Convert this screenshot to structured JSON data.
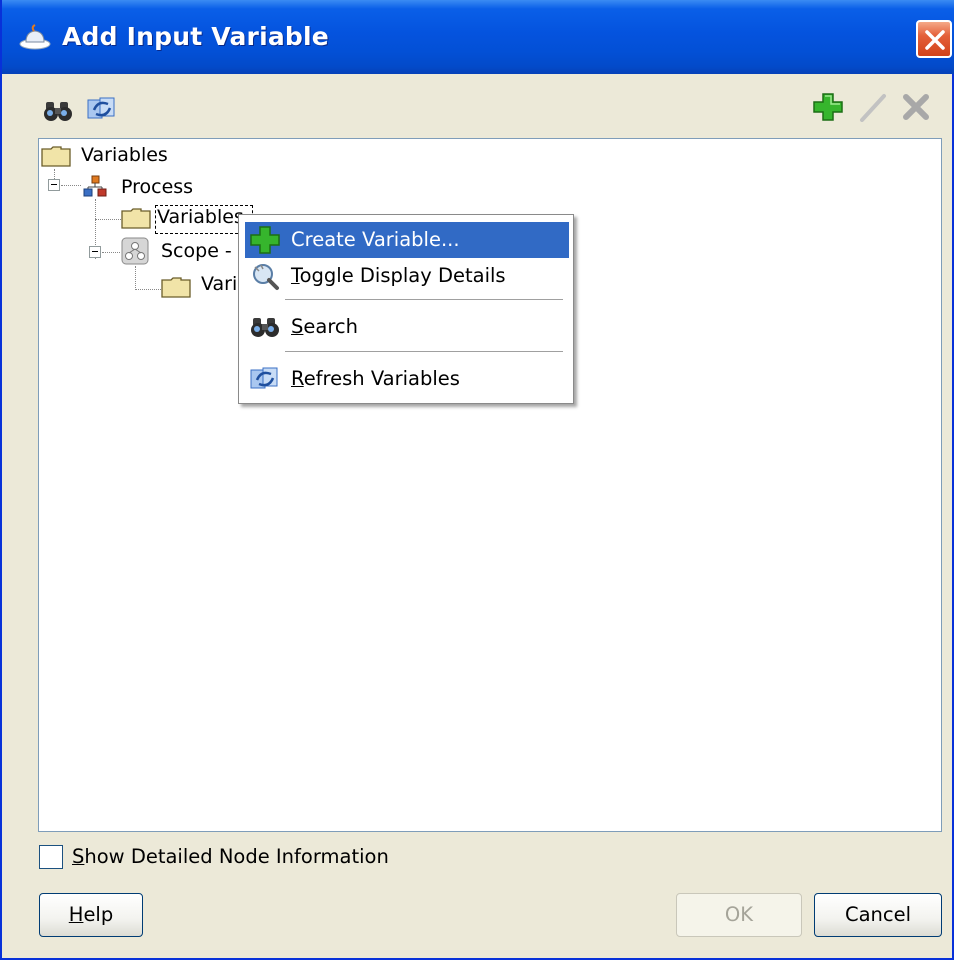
{
  "window": {
    "title": "Add Input Variable"
  },
  "toolbar": {
    "left_icons": [
      "binoculars-icon",
      "refresh-icon"
    ],
    "right_icons": [
      "add-icon",
      "edit-icon",
      "delete-icon"
    ]
  },
  "tree": {
    "root": "Variables",
    "process": "Process",
    "process_variables": "Variables",
    "scope": "Scope -",
    "scope_variables": "Vari"
  },
  "context_menu": {
    "create_variable": "Create Variable...",
    "toggle_prefix": "T",
    "toggle_rest": "oggle Display Details",
    "search_prefix": "S",
    "search_rest": "earch",
    "refresh_prefix": "R",
    "refresh_rest": "efresh Variables"
  },
  "options": {
    "show_detailed_prefix": "S",
    "show_detailed_rest": "how Detailed Node Information",
    "show_detailed_checked": false
  },
  "buttons": {
    "help_prefix": "H",
    "help_rest": "elp",
    "ok": "OK",
    "cancel": "Cancel"
  },
  "colors": {
    "titlebar": "#0453de",
    "highlight": "#316ac5",
    "dialog_bg": "#ece9d8"
  }
}
